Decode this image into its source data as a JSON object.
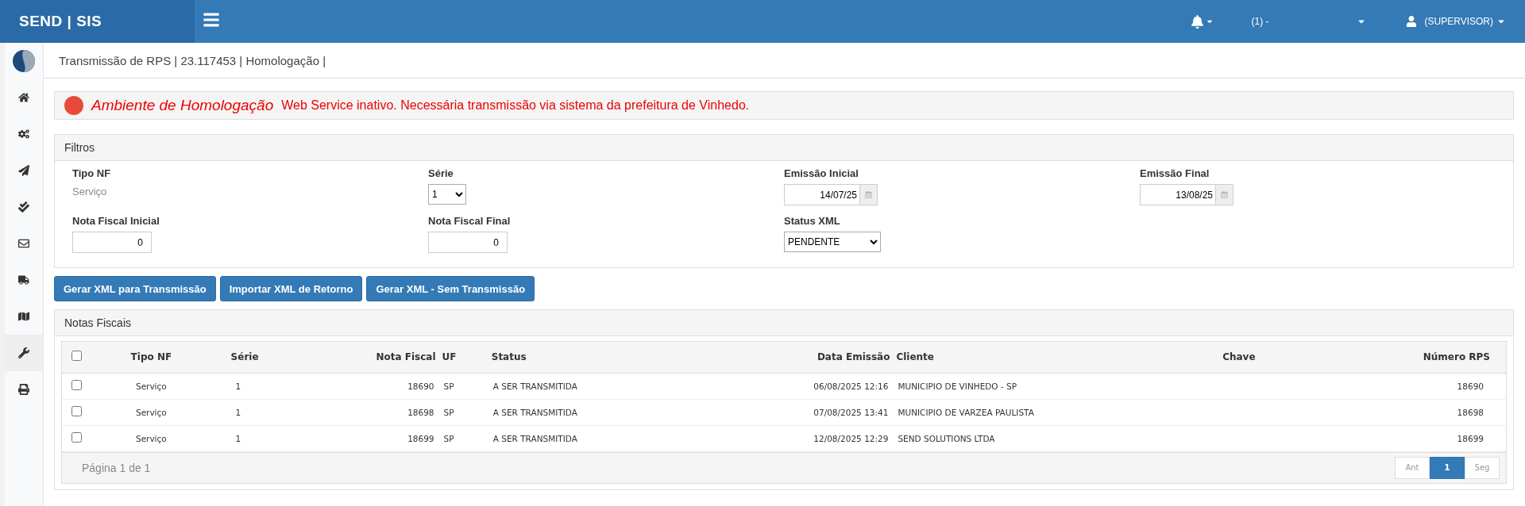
{
  "topbar": {
    "brand": "SEND | SIS",
    "company": "(1) -",
    "user": "(SUPERVISOR)"
  },
  "sidebar": {
    "items": [
      {
        "selected": false
      },
      {
        "selected": false
      },
      {
        "selected": false
      },
      {
        "selected": false
      },
      {
        "selected": false
      },
      {
        "selected": false
      },
      {
        "selected": false
      },
      {
        "selected": true
      },
      {
        "selected": false
      }
    ]
  },
  "breadcrumb": "Transmissão de RPS | 23.117453 | Homologação |",
  "alert": {
    "title": "Ambiente de Homologação",
    "message": "Web Service inativo. Necessária transmissão via sistema da prefeitura de Vinhedo."
  },
  "filters": {
    "title": "Filtros",
    "fields": [
      {
        "kind": "static",
        "label": "Tipo NF",
        "value": "Serviço"
      },
      {
        "kind": "select",
        "label": "Série",
        "value": "1"
      },
      {
        "kind": "date",
        "label": "Emissão Inicial",
        "value": "14/07/25"
      },
      {
        "kind": "date",
        "label": "Emissão Final",
        "value": "13/08/25"
      },
      {
        "kind": "number",
        "label": "Nota Fiscal Inicial",
        "value": "0"
      },
      {
        "kind": "number",
        "label": "Nota Fiscal Final",
        "value": "0"
      },
      {
        "kind": "select",
        "label": "Status XML",
        "value": "PENDENTE"
      }
    ]
  },
  "actions": [
    "Gerar XML para Transmissão",
    "Importar XML de Retorno",
    "Gerar XML - Sem Transmissão"
  ],
  "table": {
    "title": "Notas Fiscais",
    "select_all_checked": false,
    "columns": [
      "Tipo NF",
      "Série",
      "Nota Fiscal",
      "UF",
      "Status",
      "Data Emissão",
      "Cliente",
      "Chave",
      "Número RPS"
    ],
    "rows": [
      {
        "checked": false,
        "cells": [
          "Serviço",
          "1",
          "18690",
          "SP",
          "A SER TRANSMITIDA",
          "06/08/2025 12:16",
          "MUNICIPIO DE VINHEDO - SP",
          "",
          "18690"
        ]
      },
      {
        "checked": false,
        "cells": [
          "Serviço",
          "1",
          "18698",
          "SP",
          "A SER TRANSMITIDA",
          "07/08/2025 13:41",
          "MUNICIPIO DE VARZEA PAULISTA",
          "",
          "18698"
        ]
      },
      {
        "checked": false,
        "cells": [
          "Serviço",
          "1",
          "18699",
          "SP",
          "A SER TRANSMITIDA",
          "12/08/2025 12:29",
          "SEND SOLUTIONS LTDA",
          "",
          "18699"
        ]
      }
    ],
    "page_info": "Página 1 de 1",
    "pagination": [
      {
        "label": "Ant",
        "selected": false,
        "disabled": true
      },
      {
        "label": "1",
        "selected": true,
        "disabled": false
      },
      {
        "label": "Seg",
        "selected": false,
        "disabled": true
      }
    ]
  }
}
